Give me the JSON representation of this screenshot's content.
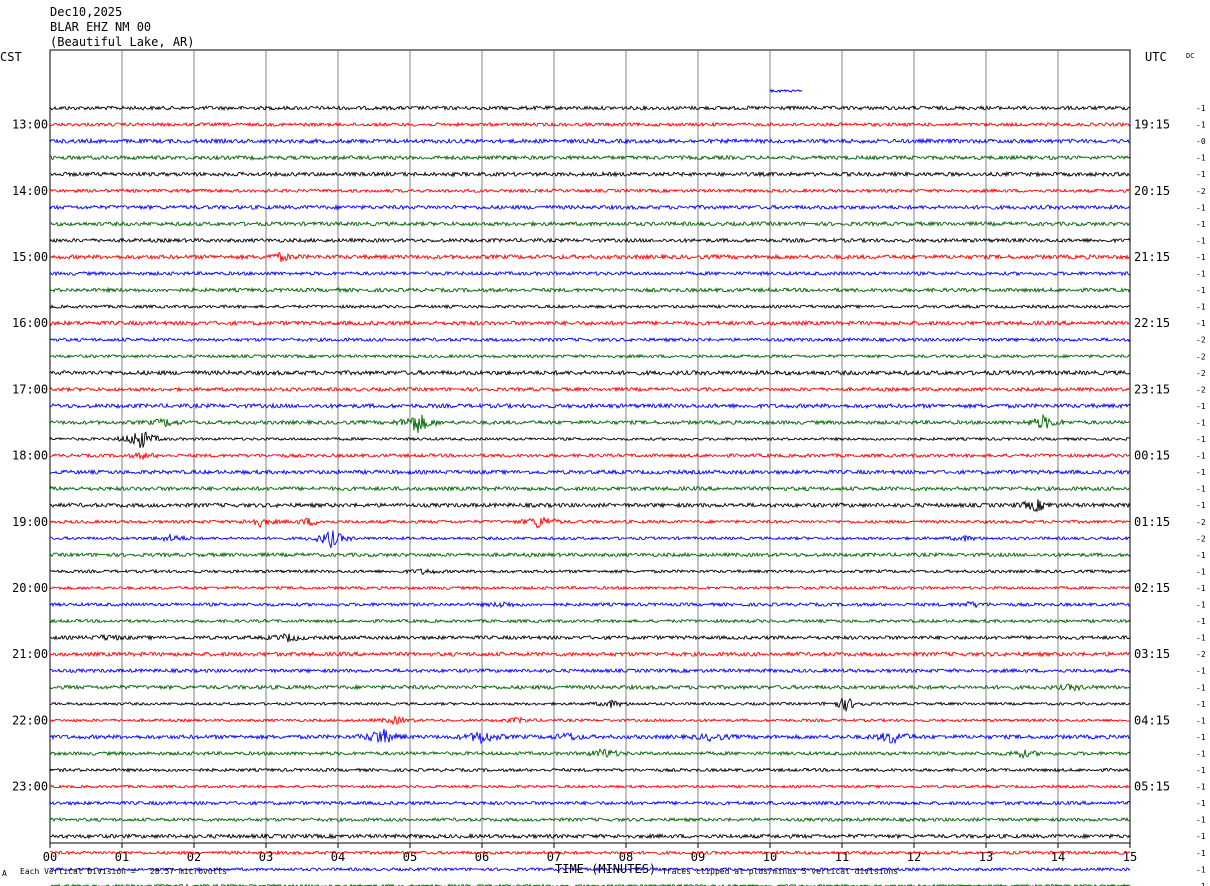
{
  "header": {
    "date": "Dec10,2025",
    "station": "BLAR EHZ NM 00",
    "location": "(Beautiful Lake, AR)"
  },
  "left_tz": "CST",
  "right_tz": "UTC",
  "dc_label": "DC",
  "footer": {
    "scale_note": "Each Vertical Division =   28.57 microvolts",
    "clip_note": "Traces clipped at plus/minus 5 vertical divisions",
    "corner_mark": "A"
  },
  "colors": {
    "black": "#000000",
    "red": "#ff0000",
    "blue": "#0000ff",
    "green": "#006400",
    "grid": "#808080",
    "tail": "#0000ff"
  },
  "chart_data": {
    "type": "line",
    "title": "BLAR EHZ NM 00",
    "xlabel": "TIME (MINUTES)",
    "ylabel": "",
    "x_ticks": [
      "00",
      "01",
      "02",
      "03",
      "04",
      "05",
      "06",
      "07",
      "08",
      "09",
      "10",
      "11",
      "12",
      "13",
      "14",
      "15"
    ],
    "xlim": [
      0,
      15
    ],
    "left_hour_labels": [
      "13:00",
      "14:00",
      "15:00",
      "16:00",
      "17:00",
      "18:00",
      "19:00",
      "20:00",
      "21:00",
      "22:00",
      "23:00"
    ],
    "right_hour_labels": [
      "19:15",
      "20:15",
      "21:15",
      "22:15",
      "23:15",
      "00:15",
      "01:15",
      "02:15",
      "03:15",
      "04:15",
      "05:15"
    ],
    "trace_color_cycle": [
      "black",
      "red",
      "blue",
      "green"
    ],
    "trace_dc_offsets": [
      "-1",
      "-1",
      "-0",
      "-1",
      "-1",
      "-2",
      "-1",
      "-1",
      "-1",
      "-1",
      "-1",
      "-1",
      "-1",
      "-1",
      "-2",
      "-2",
      "-2",
      "-2",
      "-1",
      "-1",
      "-1",
      "-1",
      "-1",
      "-1",
      "-1",
      "-2",
      "-2",
      "-1",
      "-1",
      "-1",
      "-1",
      "-1",
      "-1",
      "-2",
      "-1",
      "-1",
      "-1",
      "-1",
      "-1",
      "-1",
      "-1",
      "-1",
      "-1",
      "-1",
      "-1",
      "-1",
      "-1",
      "-1"
    ],
    "events": [
      {
        "trace": 20,
        "minute": 1.25,
        "amplitude": 5
      },
      {
        "trace": 19,
        "minute": 5.1,
        "amplitude": 5
      },
      {
        "trace": 19,
        "minute": 13.8,
        "amplitude": 3
      },
      {
        "trace": 19,
        "minute": 1.6,
        "amplitude": 1.5
      },
      {
        "trace": 21,
        "minute": 1.3,
        "amplitude": 1
      },
      {
        "trace": 24,
        "minute": 13.7,
        "amplitude": 2.5
      },
      {
        "trace": 25,
        "minute": 2.9,
        "amplitude": 2
      },
      {
        "trace": 25,
        "minute": 6.8,
        "amplitude": 3
      },
      {
        "trace": 25,
        "minute": 3.6,
        "amplitude": 1.5
      },
      {
        "trace": 26,
        "minute": 3.9,
        "amplitude": 4
      },
      {
        "trace": 26,
        "minute": 1.7,
        "amplitude": 1.5
      },
      {
        "trace": 26,
        "minute": 12.7,
        "amplitude": 1
      },
      {
        "trace": 28,
        "minute": 5.2,
        "amplitude": 1
      },
      {
        "trace": 32,
        "minute": 3.3,
        "amplitude": 1.5
      },
      {
        "trace": 32,
        "minute": 0.8,
        "amplitude": 1
      },
      {
        "trace": 30,
        "minute": 6.3,
        "amplitude": 1
      },
      {
        "trace": 30,
        "minute": 12.8,
        "amplitude": 1
      },
      {
        "trace": 36,
        "minute": 11.05,
        "amplitude": 3
      },
      {
        "trace": 36,
        "minute": 7.8,
        "amplitude": 1.5
      },
      {
        "trace": 37,
        "minute": 4.8,
        "amplitude": 1.5
      },
      {
        "trace": 37,
        "minute": 6.5,
        "amplitude": 1
      },
      {
        "trace": 38,
        "minute": 4.6,
        "amplitude": 4
      },
      {
        "trace": 38,
        "minute": 6.0,
        "amplitude": 3
      },
      {
        "trace": 38,
        "minute": 11.7,
        "amplitude": 3
      },
      {
        "trace": 38,
        "minute": 9.2,
        "amplitude": 1.5
      },
      {
        "trace": 38,
        "minute": 7.2,
        "amplitude": 1.5
      },
      {
        "trace": 39,
        "minute": 7.7,
        "amplitude": 2
      },
      {
        "trace": 39,
        "minute": 13.5,
        "amplitude": 1.5
      },
      {
        "trace": 9,
        "minute": 3.2,
        "amplitude": 1.5
      },
      {
        "trace": 35,
        "minute": 14.2,
        "amplitude": 1
      }
    ]
  }
}
